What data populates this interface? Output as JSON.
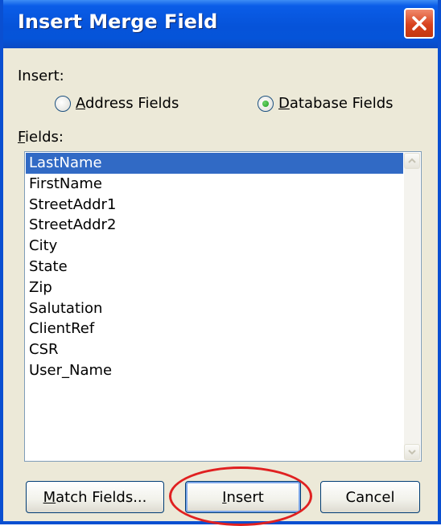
{
  "window": {
    "title": "Insert Merge Field"
  },
  "insert": {
    "label": "Insert:",
    "options": [
      {
        "prefix": "",
        "accel": "A",
        "rest": "ddress Fields",
        "selected": false
      },
      {
        "prefix": "",
        "accel": "D",
        "rest": "atabase Fields",
        "selected": true
      }
    ]
  },
  "fields": {
    "label_accel": "F",
    "label_rest": "ields:",
    "items": [
      "LastName",
      "FirstName",
      "StreetAddr1",
      "StreetAddr2",
      "City",
      "State",
      "Zip",
      "Salutation",
      "ClientRef",
      "CSR",
      "User_Name"
    ],
    "selected_index": 0
  },
  "buttons": {
    "match": {
      "accel": "M",
      "rest": "atch Fields..."
    },
    "insert": {
      "accel": "I",
      "rest": "nsert"
    },
    "cancel": {
      "label": "Cancel"
    }
  },
  "icons": {
    "close": "close-icon",
    "scroll_up": "scroll-up-arrow-icon",
    "scroll_down": "scroll-down-arrow-icon",
    "radio": "radio-icon"
  },
  "colors": {
    "title_bar": "#0a5de8",
    "selection": "#316ac5",
    "annotation": "#e02020"
  }
}
